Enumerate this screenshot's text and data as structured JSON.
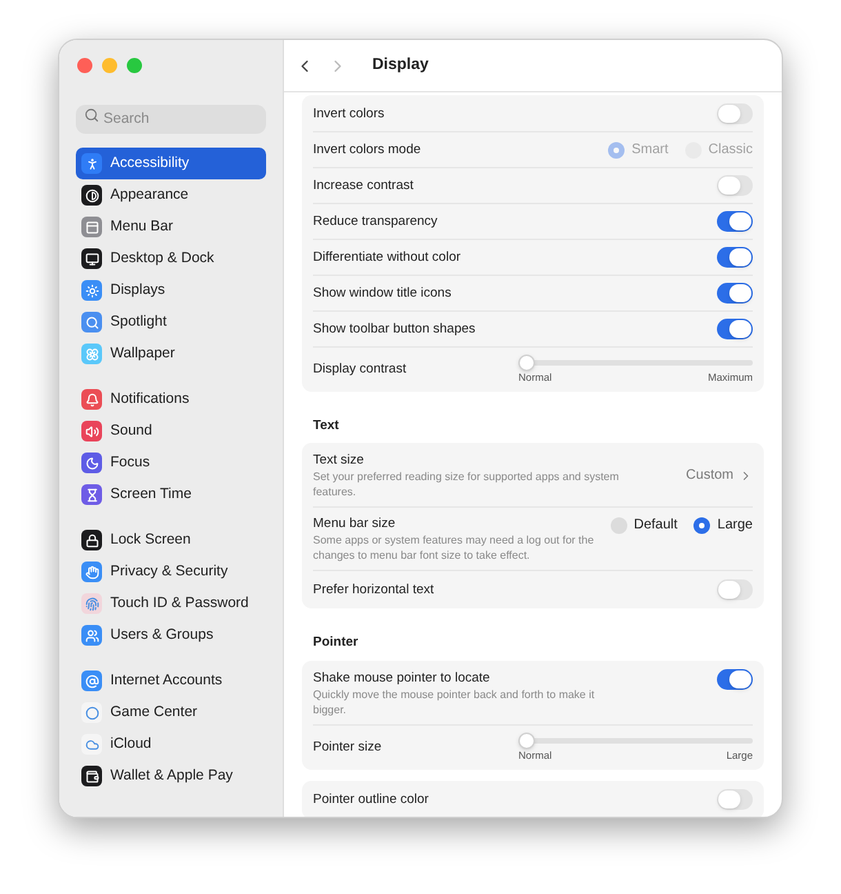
{
  "window": {
    "title": "Display"
  },
  "sidebar": {
    "search": {
      "placeholder": "Search"
    },
    "groups": [
      [
        {
          "label": "Accessibility",
          "selected": true,
          "color": "#2f7cf6"
        },
        {
          "label": "Appearance",
          "selected": false,
          "color": "#1c1c1e"
        },
        {
          "label": "Menu Bar",
          "selected": false,
          "color": "#8e8e93"
        },
        {
          "label": "Desktop & Dock",
          "selected": false,
          "color": "#1c1c1e"
        },
        {
          "label": "Displays",
          "selected": false,
          "color": "#3a8ef6"
        },
        {
          "label": "Spotlight",
          "selected": false,
          "color": "#4a8ff0"
        },
        {
          "label": "Wallpaper",
          "selected": false,
          "color": "#5ac8fa"
        }
      ],
      [
        {
          "label": "Notifications",
          "selected": false,
          "color": "#eb4d55"
        },
        {
          "label": "Sound",
          "selected": false,
          "color": "#e9445a"
        },
        {
          "label": "Focus",
          "selected": false,
          "color": "#5e5ce6"
        },
        {
          "label": "Screen Time",
          "selected": false,
          "color": "#6e5ce6"
        }
      ],
      [
        {
          "label": "Lock Screen",
          "selected": false,
          "color": "#1c1c1e"
        },
        {
          "label": "Privacy & Security",
          "selected": false,
          "color": "#3a8ef6"
        },
        {
          "label": "Touch ID & Password",
          "selected": false,
          "color": "#f2d6dc"
        },
        {
          "label": "Users & Groups",
          "selected": false,
          "color": "#3a8ef6"
        }
      ],
      [
        {
          "label": "Internet Accounts",
          "selected": false,
          "color": "#3a8ef6"
        },
        {
          "label": "Game Center",
          "selected": false,
          "color": "#f5f5f5"
        },
        {
          "label": "iCloud",
          "selected": false,
          "color": "#f5f5f5"
        },
        {
          "label": "Wallet & Apple Pay",
          "selected": false,
          "color": "#1c1c1e"
        }
      ]
    ]
  },
  "sections": [
    {
      "rows": [
        {
          "kind": "toggle",
          "label": "Invert colors",
          "on": false
        },
        {
          "kind": "radio",
          "label": "Invert colors mode",
          "disabled": true,
          "options": [
            {
              "label": "Smart",
              "selected": true
            },
            {
              "label": "Classic",
              "selected": false
            }
          ]
        },
        {
          "kind": "toggle",
          "label": "Increase contrast",
          "on": false
        },
        {
          "kind": "toggle",
          "label": "Reduce transparency",
          "on": true
        },
        {
          "kind": "toggle",
          "label": "Differentiate without color",
          "on": true
        },
        {
          "kind": "toggle",
          "label": "Show window title icons",
          "on": true
        },
        {
          "kind": "toggle",
          "label": "Show toolbar button shapes",
          "on": true
        },
        {
          "kind": "slider",
          "label": "Display contrast",
          "level": 0,
          "min_label": "Normal",
          "max_label": "Maximum"
        }
      ]
    },
    {
      "heading": "Text",
      "rows": [
        {
          "kind": "link",
          "label": "Text size",
          "description": "Set your preferred reading size for supported apps and system features.",
          "value": "Custom"
        },
        {
          "kind": "radio",
          "label": "Menu bar size",
          "disabled": false,
          "description": "Some apps or system features may need a log out for the changes to menu bar font size to take effect.",
          "options": [
            {
              "label": "Default",
              "selected": false
            },
            {
              "label": "Large",
              "selected": true
            }
          ]
        },
        {
          "kind": "toggle",
          "label": "Prefer horizontal text",
          "on": false
        }
      ]
    },
    {
      "heading": "Pointer",
      "rows": [
        {
          "kind": "toggle",
          "label": "Shake mouse pointer to locate",
          "on": true,
          "description": "Quickly move the mouse pointer back and forth to make it bigger."
        },
        {
          "kind": "slider",
          "label": "Pointer size",
          "level": 0,
          "min_label": "Normal",
          "max_label": "Large"
        }
      ]
    },
    {
      "rows": [
        {
          "kind": "toggle",
          "label": "Pointer outline color",
          "on": false
        }
      ]
    }
  ]
}
